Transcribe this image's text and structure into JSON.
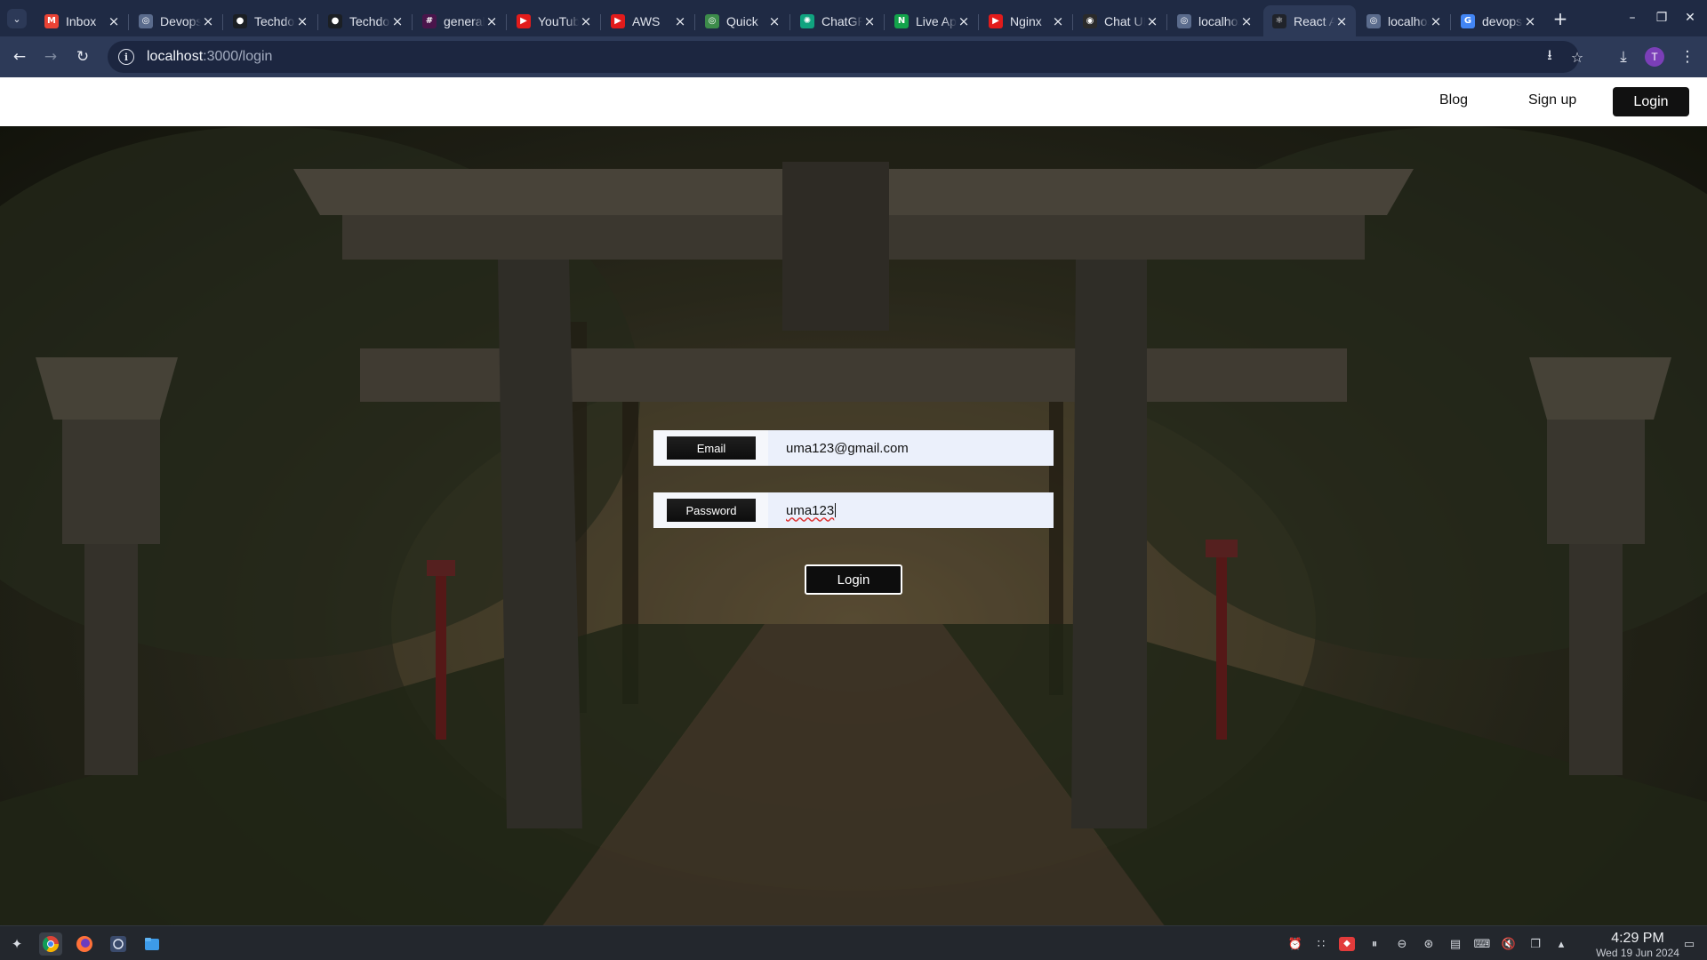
{
  "browser": {
    "tabs": [
      {
        "title": "Inbox",
        "icon": "gmail-icon",
        "color": "#ea4335",
        "glyph": "M"
      },
      {
        "title": "Devops",
        "icon": "globe-icon",
        "color": "#5a6b8c",
        "glyph": "◎"
      },
      {
        "title": "Techdo",
        "icon": "github-icon",
        "color": "#1b1f24",
        "glyph": "●"
      },
      {
        "title": "Techdo",
        "icon": "github-icon",
        "color": "#1b1f24",
        "glyph": "●"
      },
      {
        "title": "general",
        "icon": "slack-icon",
        "color": "#4a154b",
        "glyph": "#"
      },
      {
        "title": "YouTube",
        "icon": "youtube-icon",
        "color": "#e21b1b",
        "glyph": "▶"
      },
      {
        "title": "AWS",
        "icon": "youtube-icon",
        "color": "#e21b1b",
        "glyph": "▶"
      },
      {
        "title": "Quick",
        "icon": "chrome-icon",
        "color": "#3c8b4a",
        "glyph": "◎"
      },
      {
        "title": "ChatGPT",
        "icon": "openai-icon",
        "color": "#10a37f",
        "glyph": "✺"
      },
      {
        "title": "Live App",
        "icon": "n-logo-icon",
        "color": "#13a34b",
        "glyph": "N"
      },
      {
        "title": "Nginx",
        "icon": "youtube-icon",
        "color": "#e21b1b",
        "glyph": "▶"
      },
      {
        "title": "Chat UI",
        "icon": "dark-app-icon",
        "color": "#2a2a2a",
        "glyph": "◉"
      },
      {
        "title": "localhost",
        "icon": "globe-icon",
        "color": "#5a6b8c",
        "glyph": "◎"
      },
      {
        "title": "React App",
        "icon": "react-icon",
        "color": "#20232a",
        "glyph": "⚛",
        "active": true
      },
      {
        "title": "localhost",
        "icon": "globe-icon",
        "color": "#5a6b8c",
        "glyph": "◎"
      },
      {
        "title": "devops",
        "icon": "google-icon",
        "color": "#4285f4",
        "glyph": "G"
      }
    ],
    "url_host": "localhost",
    "url_path": ":3000/login",
    "profile_initial": "T"
  },
  "navbar": {
    "blog_label": "Blog",
    "signup_label": "Sign up",
    "login_label": "Login"
  },
  "form": {
    "email_label": "Email",
    "email_value": "uma123@gmail.com",
    "password_label": "Password",
    "password_value": "uma123",
    "submit_label": "Login"
  },
  "taskbar": {
    "time": "4:29 PM",
    "date": "Wed 19 Jun 2024"
  }
}
